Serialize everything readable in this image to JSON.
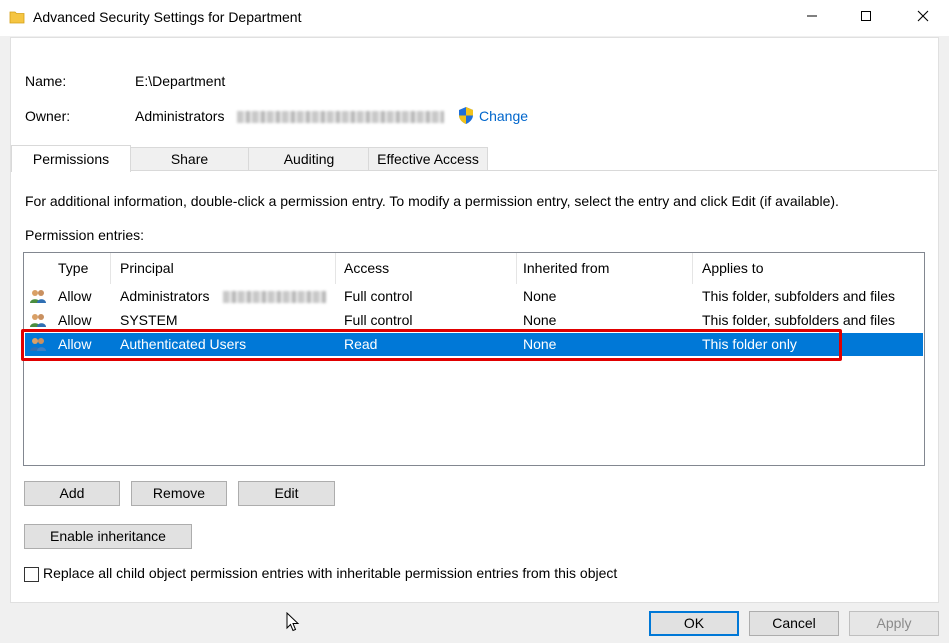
{
  "window": {
    "title": "Advanced Security Settings for Department",
    "icon": "folder-icon"
  },
  "info": {
    "name_label": "Name:",
    "name_value": "E:\\Department",
    "owner_label": "Owner:",
    "owner_value": "Administrators",
    "change_label": "Change",
    "change_icon": "shield-icon"
  },
  "tabs": [
    {
      "label": "Permissions",
      "active": true
    },
    {
      "label": "Share",
      "active": false
    },
    {
      "label": "Auditing",
      "active": false
    },
    {
      "label": "Effective Access",
      "active": false
    }
  ],
  "permissions": {
    "info_text": "For additional information, double-click a permission entry. To modify a permission entry, select the entry and click Edit (if available).",
    "entries_label": "Permission entries:",
    "columns": [
      "Type",
      "Principal",
      "Access",
      "Inherited from",
      "Applies to"
    ],
    "rows": [
      {
        "type": "Allow",
        "principal": "Administrators",
        "access": "Full control",
        "inherited": "None",
        "applies": "This folder, subfolders and files",
        "selected": false
      },
      {
        "type": "Allow",
        "principal": "SYSTEM",
        "access": "Full control",
        "inherited": "None",
        "applies": "This folder, subfolders and files",
        "selected": false
      },
      {
        "type": "Allow",
        "principal": "Authenticated Users",
        "access": "Read",
        "inherited": "None",
        "applies": "This folder only",
        "selected": true
      }
    ]
  },
  "buttons": {
    "add": "Add",
    "remove": "Remove",
    "edit": "Edit",
    "enable_inheritance": "Enable inheritance",
    "ok": "OK",
    "cancel": "Cancel",
    "apply": "Apply"
  },
  "replace_checkbox": {
    "label": "Replace all child object permission entries with inheritable permission entries from this object",
    "checked": false
  },
  "colors": {
    "selection": "#0078d7",
    "highlight_box": "#e00000",
    "link": "#0066cc"
  }
}
